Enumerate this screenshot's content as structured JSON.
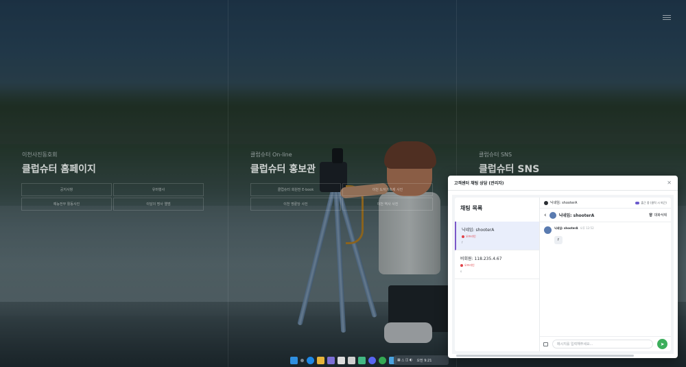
{
  "page": {
    "columns": [
      {
        "subtitle": "이천사진동호회",
        "title": "클럽슈터 홈페이지",
        "buttons": [
          "공지사항",
          "유머행사",
          "예능전부 활동사진",
          "이달의 명사 앨범"
        ]
      },
      {
        "subtitle": "클럽슈터 On-line",
        "title": "클럽슈터 홍보관",
        "buttons": [
          "클럽슈터 회원전 E-book",
          "이천 도자기축제 사진",
          "이천 명륜당 사진",
          "이천 역사 사진"
        ]
      },
      {
        "subtitle": "클럽슈터 SNS",
        "title": "클럽슈터 SNS",
        "buttons": []
      }
    ]
  },
  "modal": {
    "title": "고객센터 채팅 상담 (관리자)",
    "close_icon": "close-icon",
    "list_title": "채팅 목록",
    "chats": [
      {
        "name": "닉네임: shooterA",
        "status": "오프라인",
        "last": "f",
        "active": true
      },
      {
        "name": "비회원: 118.235.4.67",
        "status": "오프라인",
        "last": "s",
        "active": false
      }
    ],
    "conversation": {
      "top_user": "닉네임: shooterA",
      "mode": "출근 중 (클릭 시 퇴근)",
      "header_name": "닉네임: shooterA",
      "delete_label": "대화삭제",
      "messages": [
        {
          "sender": "닉네임: shooterA",
          "time": "오후 12:52",
          "text": "f"
        }
      ],
      "input_placeholder": "메시지를 입력해주세요..."
    }
  },
  "taskbar": {
    "tray_text": "오전 9:21"
  },
  "colors": {
    "accent_purple": "#7b57c9",
    "send_green": "#3cae5c",
    "offline_red": "#e0434a"
  }
}
